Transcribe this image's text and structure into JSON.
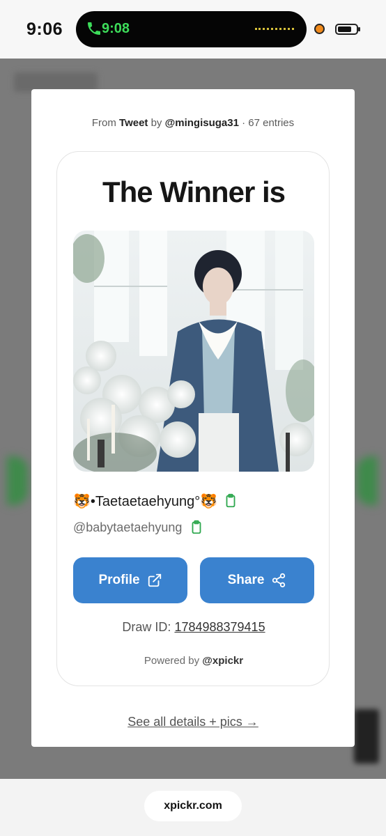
{
  "status_bar": {
    "time": "9:06",
    "call_time": "9:08"
  },
  "modal": {
    "source": {
      "prefix": "From",
      "platform": "Tweet",
      "by": "by",
      "author": "@mingisuga31",
      "entries": "· 67 entries"
    },
    "title": "The Winner is",
    "winner": {
      "display_name": "🐯•Taetaetaehyung°🐯",
      "handle": "@babytaetaehyung"
    },
    "buttons": {
      "profile": "Profile",
      "share": "Share"
    },
    "draw_id": {
      "label": "Draw ID:",
      "value": "1784988379415"
    },
    "powered": {
      "prefix": "Powered by",
      "brand": "@xpickr"
    },
    "details_link": "See all details + pics →"
  },
  "browser": {
    "url": "xpickr.com"
  },
  "colors": {
    "primary_button": "#3a82cf",
    "copy_icon": "#2fa84f",
    "call_green": "#3ddc5a"
  }
}
